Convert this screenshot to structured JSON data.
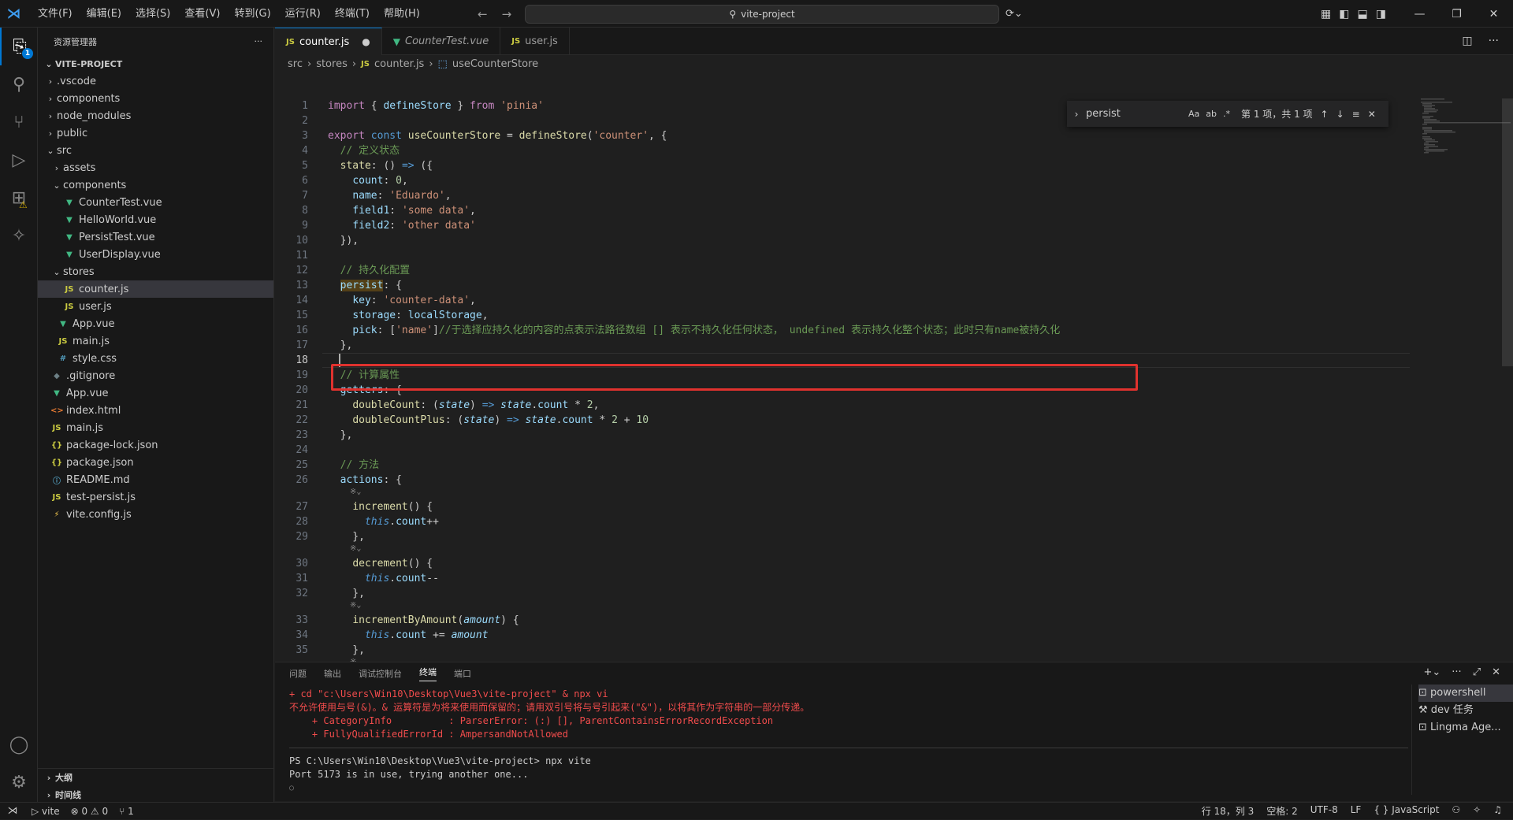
{
  "menu": [
    "文件(F)",
    "编辑(E)",
    "选择(S)",
    "查看(V)",
    "转到(G)",
    "运行(R)",
    "终端(T)",
    "帮助(H)"
  ],
  "command_center": "vite-project",
  "sidebar": {
    "title": "资源管理器",
    "project": "VITE-PROJECT",
    "tree": [
      {
        "label": ".vscode",
        "type": "folder",
        "depth": 1,
        "open": false
      },
      {
        "label": "components",
        "type": "folder",
        "depth": 1,
        "open": false
      },
      {
        "label": "node_modules",
        "type": "folder",
        "depth": 1,
        "open": false
      },
      {
        "label": "public",
        "type": "folder",
        "depth": 1,
        "open": false
      },
      {
        "label": "src",
        "type": "folder",
        "depth": 1,
        "open": true
      },
      {
        "label": "assets",
        "type": "folder",
        "depth": 2,
        "open": false
      },
      {
        "label": "components",
        "type": "folder",
        "depth": 2,
        "open": true
      },
      {
        "label": "CounterTest.vue",
        "type": "vue",
        "depth": 3
      },
      {
        "label": "HelloWorld.vue",
        "type": "vue",
        "depth": 3
      },
      {
        "label": "PersistTest.vue",
        "type": "vue",
        "depth": 3
      },
      {
        "label": "UserDisplay.vue",
        "type": "vue",
        "depth": 3
      },
      {
        "label": "stores",
        "type": "folder",
        "depth": 2,
        "open": true
      },
      {
        "label": "counter.js",
        "type": "js",
        "depth": 3,
        "selected": true
      },
      {
        "label": "user.js",
        "type": "js",
        "depth": 3
      },
      {
        "label": "App.vue",
        "type": "vue",
        "depth": 2
      },
      {
        "label": "main.js",
        "type": "js",
        "depth": 2
      },
      {
        "label": "style.css",
        "type": "css",
        "depth": 2
      },
      {
        "label": ".gitignore",
        "type": "git",
        "depth": 1
      },
      {
        "label": "App.vue",
        "type": "vue",
        "depth": 1
      },
      {
        "label": "index.html",
        "type": "html",
        "depth": 1
      },
      {
        "label": "main.js",
        "type": "js",
        "depth": 1
      },
      {
        "label": "package-lock.json",
        "type": "json",
        "depth": 1
      },
      {
        "label": "package.json",
        "type": "json",
        "depth": 1
      },
      {
        "label": "README.md",
        "type": "info",
        "depth": 1
      },
      {
        "label": "test-persist.js",
        "type": "js",
        "depth": 1
      },
      {
        "label": "vite.config.js",
        "type": "vite",
        "depth": 1
      }
    ],
    "outline": "大纲",
    "timeline": "时间线"
  },
  "tabs": [
    {
      "label": "counter.js",
      "kind": "js",
      "active": true,
      "dirty": true
    },
    {
      "label": "CounterTest.vue",
      "kind": "vue",
      "active": false
    },
    {
      "label": "user.js",
      "kind": "js",
      "active": false
    }
  ],
  "breadcrumb": [
    "src",
    "stores",
    "counter.js",
    "useCounterStore"
  ],
  "find": {
    "query": "persist",
    "result": "第 1 项，共 1 项",
    "opts": [
      "Aa",
      "ab",
      ".*"
    ]
  },
  "code_lines": [
    {
      "n": 1,
      "html": "<span class=\"k\">import</span> { <span class=\"v\">defineStore</span> } <span class=\"k\">from</span> <span class=\"s\">'pinia'</span>"
    },
    {
      "n": 2,
      "html": ""
    },
    {
      "n": 3,
      "html": "<span class=\"k\">export</span> <span class=\"kb\">const</span> <span class=\"f\">useCounterStore</span> = <span class=\"f\">defineStore</span>(<span class=\"s\">'counter'</span>, {"
    },
    {
      "n": 4,
      "html": "  <span class=\"c\">// 定义状态</span>"
    },
    {
      "n": 5,
      "html": "  <span class=\"f\">state</span>: () <span class=\"kb\">=></span> ({"
    },
    {
      "n": 6,
      "html": "    <span class=\"p\">count</span>: <span class=\"n\">0</span>,"
    },
    {
      "n": 7,
      "html": "    <span class=\"p\">name</span>: <span class=\"s\">'Eduardo'</span>,"
    },
    {
      "n": 8,
      "html": "    <span class=\"p\">field1</span>: <span class=\"s\">'some data'</span>,"
    },
    {
      "n": 9,
      "html": "    <span class=\"p\">field2</span>: <span class=\"s\">'other data'</span>"
    },
    {
      "n": 10,
      "html": "  }),"
    },
    {
      "n": 11,
      "html": ""
    },
    {
      "n": 12,
      "html": "  <span class=\"c\">// 持久化配置</span>"
    },
    {
      "n": 13,
      "html": "  <span class=\"p hl\">persist</span>: {"
    },
    {
      "n": 14,
      "html": "    <span class=\"p\">key</span>: <span class=\"s\">'counter-data'</span>,"
    },
    {
      "n": 15,
      "html": "    <span class=\"p\">storage</span>: <span class=\"v\">localStorage</span>,"
    },
    {
      "n": 16,
      "html": "    <span class=\"p\">pick</span>: [<span class=\"s\">'name'</span>]<span class=\"c\">//于选择应持久化的内容的点表示法路径数组 [] 表示不持久化任何状态， undefined 表示持久化整个状态；此时只有name被持久化</span>"
    },
    {
      "n": 17,
      "html": "  },"
    },
    {
      "n": 18,
      "html": "",
      "current": true
    },
    {
      "n": 19,
      "html": "  <span class=\"c\">// 计算属性</span>"
    },
    {
      "n": 20,
      "html": "  <span class=\"p\">getters</span>: {"
    },
    {
      "n": 21,
      "html": "    <span class=\"f\">doubleCount</span>: (<span class=\"v it\">state</span>) <span class=\"kb\">=></span> <span class=\"v it\">state</span>.<span class=\"p\">count</span> * <span class=\"n\">2</span>,"
    },
    {
      "n": 22,
      "html": "    <span class=\"f\">doubleCountPlus</span>: (<span class=\"v it\">state</span>) <span class=\"kb\">=></span> <span class=\"v it\">state</span>.<span class=\"p\">count</span> * <span class=\"n\">2</span> + <span class=\"n\">10</span>"
    },
    {
      "n": 23,
      "html": "  },"
    },
    {
      "n": 24,
      "html": ""
    },
    {
      "n": 25,
      "html": "  <span class=\"c\">// 方法</span>"
    },
    {
      "n": 26,
      "html": "  <span class=\"p\">actions</span>: {",
      "lens_after": "※⌄"
    },
    {
      "n": 27,
      "html": "    <span class=\"f\">increment</span>() {"
    },
    {
      "n": 28,
      "html": "      <span class=\"kb it\">this</span>.<span class=\"p\">count</span>++"
    },
    {
      "n": 29,
      "html": "    },",
      "lens_after": "※⌄"
    },
    {
      "n": 30,
      "html": "    <span class=\"f\">decrement</span>() {"
    },
    {
      "n": 31,
      "html": "      <span class=\"kb it\">this</span>.<span class=\"p\">count</span>--"
    },
    {
      "n": 32,
      "html": "    },",
      "lens_after": "※⌄"
    },
    {
      "n": 33,
      "html": "    <span class=\"f\">incrementByAmount</span>(<span class=\"v it\">amount</span>) {"
    },
    {
      "n": 34,
      "html": "      <span class=\"kb it\">this</span>.<span class=\"p\">count</span> += <span class=\"v it\">amount</span>"
    },
    {
      "n": 35,
      "html": "    },",
      "lens_after": "※⌄"
    }
  ],
  "panel": {
    "tabs": [
      "问题",
      "输出",
      "调试控制台",
      "终端",
      "端口"
    ],
    "active_tab": "终端",
    "terminal": [
      {
        "text": "+ cd \"c:\\Users\\Win10\\Desktop\\Vue3\\vite-project\" & npx vi",
        "cls": "err"
      },
      {
        "text": "不允许使用与号(&)。& 运算符是为将来使用而保留的；请用双引号将与号引起来(\"&\")，以将其作为字符串的一部分传递。",
        "cls": "err"
      },
      {
        "text": "    + CategoryInfo          : ParserError: (:) [], ParentContainsErrorRecordException",
        "cls": "err"
      },
      {
        "text": "    + FullyQualifiedErrorId : AmpersandNotAllowed",
        "cls": "err"
      },
      {
        "text": "",
        "cls": "sep"
      },
      {
        "text": "PS C:\\Users\\Win10\\Desktop\\Vue3\\vite-project> npx vite",
        "cls": ""
      },
      {
        "text": "Port 5173 is in use, trying another one...",
        "cls": ""
      }
    ],
    "terminals": [
      "powershell",
      "dev 任务",
      "Lingma Age..."
    ]
  },
  "status": {
    "run": "vite",
    "errors": "0",
    "warnings": "0",
    "ports": "1",
    "position": "行 18，列 3",
    "spaces": "空格: 2",
    "encoding": "UTF-8",
    "eol": "LF",
    "language": "JavaScript"
  },
  "colors": {
    "accent": "#0078d4",
    "highlight_box": "#e0322e"
  }
}
